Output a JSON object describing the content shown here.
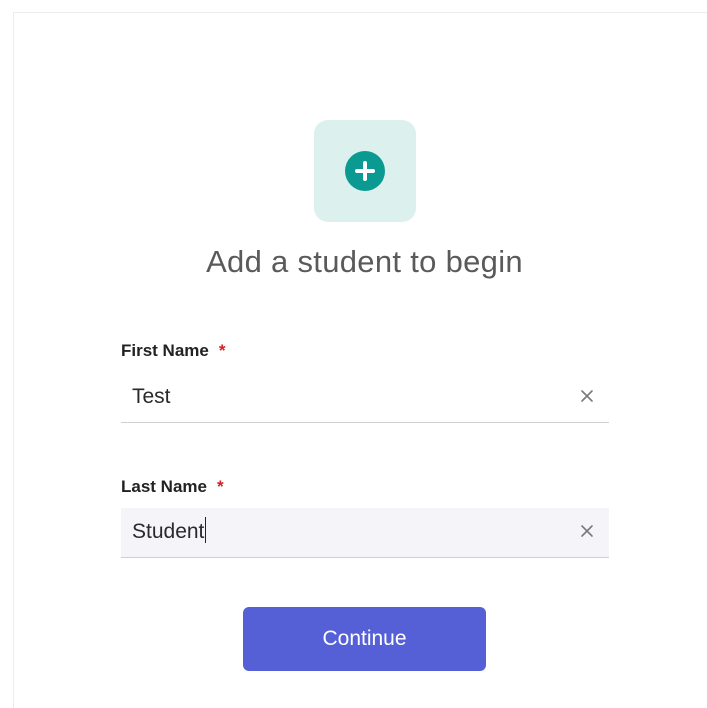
{
  "header": {
    "icon": "plus-circle-icon",
    "title": "Add a student to begin"
  },
  "form": {
    "first_name": {
      "label": "First Name",
      "required_marker": "*",
      "value": "Test",
      "clear_icon": "close-icon"
    },
    "last_name": {
      "label": "Last Name",
      "required_marker": "*",
      "value": "Student",
      "clear_icon": "close-icon"
    }
  },
  "actions": {
    "continue_label": "Continue"
  },
  "colors": {
    "accent": "#5560d6",
    "icon_teal": "#0a9a92",
    "icon_tile": "#dcf0ee",
    "required": "#d02020"
  }
}
